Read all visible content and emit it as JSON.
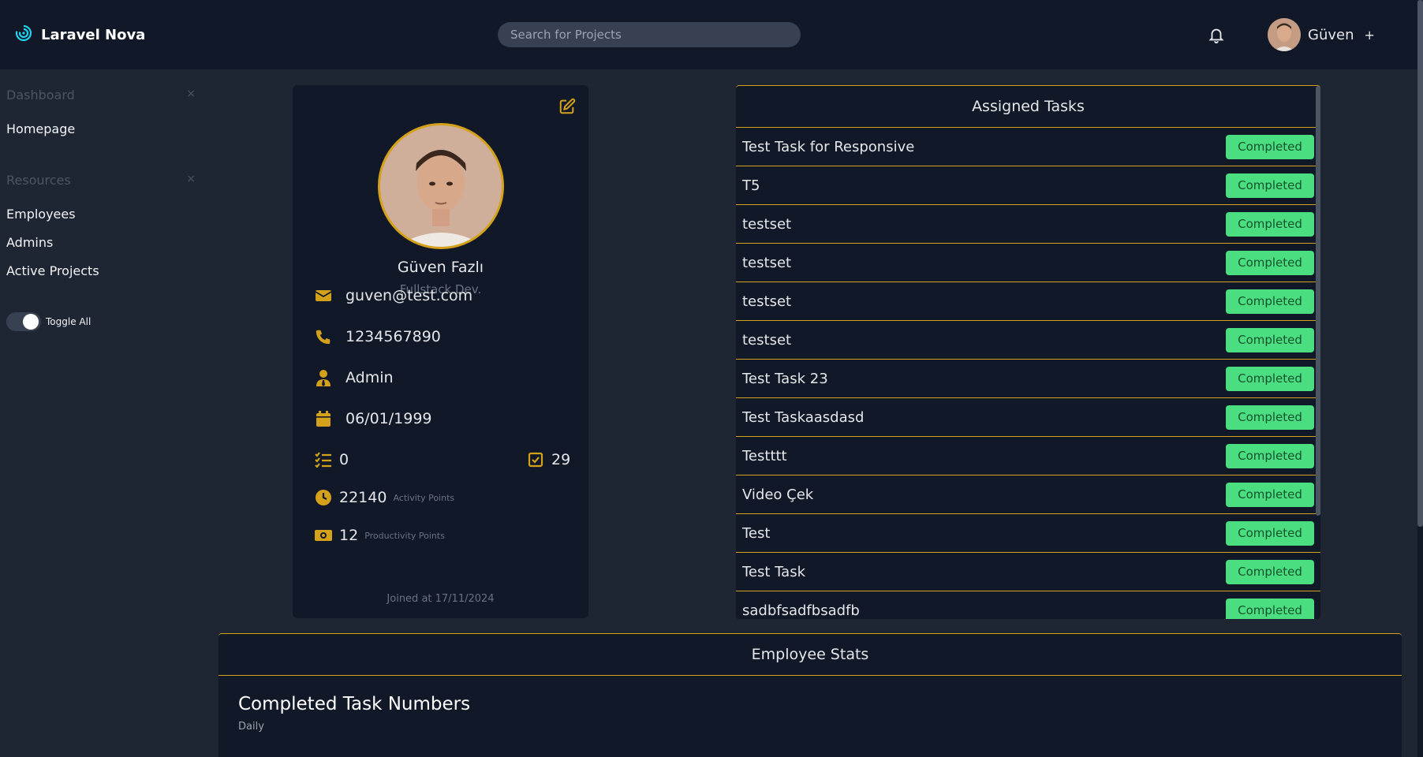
{
  "app": {
    "title": "Laravel Nova"
  },
  "header": {
    "search_placeholder": "Search for Projects",
    "user_name": "Güven",
    "user_plus": "+"
  },
  "sidebar": {
    "sections": [
      {
        "title": "Dashboard",
        "items": [
          "Homepage"
        ]
      },
      {
        "title": "Resources",
        "items": [
          "Employees",
          "Admins",
          "Active Projects"
        ]
      }
    ],
    "collapse_symbol": "×",
    "toggle_label": "Toggle All",
    "toggle_on": true
  },
  "profile": {
    "name": "Güven Fazlı",
    "role": "Fullstack Dev.",
    "email": "guven@test.com",
    "phone": "1234567890",
    "position": "Admin",
    "birthdate": "06/01/1999",
    "open_tasks": "0",
    "completed_tasks": "29",
    "activity_points": "22140",
    "activity_label": "Activity Points",
    "productivity_points": "12",
    "productivity_label": "Productivity Points",
    "joined": "Joined at 17/11/2024"
  },
  "tasks": {
    "title": "Assigned Tasks",
    "items": [
      {
        "name": "Test Task for Responsive",
        "status": "Completed"
      },
      {
        "name": "T5",
        "status": "Completed"
      },
      {
        "name": "testset",
        "status": "Completed"
      },
      {
        "name": "testset",
        "status": "Completed"
      },
      {
        "name": "testset",
        "status": "Completed"
      },
      {
        "name": "testset",
        "status": "Completed"
      },
      {
        "name": "Test Task 23",
        "status": "Completed"
      },
      {
        "name": "Test Taskaasdasd",
        "status": "Completed"
      },
      {
        "name": "Testttt",
        "status": "Completed"
      },
      {
        "name": "Video Çek",
        "status": "Completed"
      },
      {
        "name": "Test",
        "status": "Completed"
      },
      {
        "name": "Test Task",
        "status": "Completed"
      },
      {
        "name": "sadbfsadfbsadfb",
        "status": "Completed"
      }
    ]
  },
  "stats": {
    "title": "Employee Stats",
    "chart_title": "Completed Task Numbers",
    "chart_subtitle": "Daily"
  },
  "colors": {
    "accent": "#d4a21a",
    "status_completed": "#4ade80",
    "brand_logo": "#22d3ee",
    "background": "#1e2533",
    "panel": "#111827"
  },
  "icons": {
    "brand": "nova-spiral-icon",
    "notifications": "bell-icon",
    "edit": "edit-icon",
    "email": "envelope-icon",
    "phone": "phone-icon",
    "position": "user-tie-icon",
    "birthdate": "calendar-icon",
    "open_tasks": "list-check-icon",
    "completed_tasks": "square-check-icon",
    "activity": "clock-icon",
    "productivity": "money-bill-icon"
  }
}
